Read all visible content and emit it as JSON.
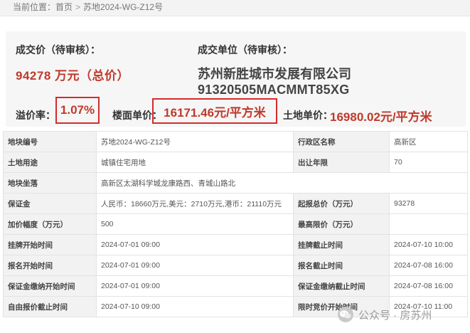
{
  "breadcrumb": {
    "prefix": "当前位置：",
    "home": "首页",
    "separator": ">",
    "current": "苏地2024-WG-Z12号"
  },
  "summary": {
    "price_label": "成交价（待审核）：",
    "price_value": "94278 万元（总价）",
    "company_label": "成交单位（待审核）：",
    "company_name": "苏州新胜城市发展有限公司",
    "company_code": "91320505MACMMT85XG",
    "premium_label": "溢价率：",
    "premium_value": "1.07%",
    "floor_price_label": "楼面单价：",
    "floor_price_value": "16171.46元/平方米",
    "land_price_label": "土地单价：",
    "land_price_value": "16980.02元/平方米"
  },
  "table": {
    "rows": [
      {
        "k1": "地块编号",
        "v1": "苏地2024-WG-Z12号",
        "k2": "行政区名称",
        "v2": "高新区"
      },
      {
        "k1": "土地用途",
        "v1": "城镇住宅用地",
        "k2": "出让年限",
        "v2": "70"
      },
      {
        "k1": "地块坐落",
        "v1": "高新区太湖科学城龙康路西、青城山路北"
      },
      {
        "k1": "保证金",
        "v1": "人民币：18660万元,美元：2710万元,港币：21110万元",
        "k2": "起报总价（万元）",
        "v2": "93278"
      },
      {
        "k1": "加价幅度（万元）",
        "v1": "500",
        "k2": "最高限价（万元）",
        "v2": ""
      },
      {
        "k1": "挂牌开始时间",
        "v1": "2024-07-01 09:00",
        "k2": "挂牌截止时间",
        "v2": "2024-07-10 10:00"
      },
      {
        "k1": "报名开始时间",
        "v1": "2024-07-01 09:00",
        "k2": "报名截止时间",
        "v2": "2024-07-08 16:00"
      },
      {
        "k1": "保证金缴纳开始时间",
        "v1": "2024-07-01 09:00",
        "k2": "保证金缴纳截止时间",
        "v2": "2024-07-08 16:00"
      },
      {
        "k1": "自由报价截止时间",
        "v1": "2024-07-10 09:00",
        "k2": "限时竞价开始时间",
        "v2": "2024-07-10 11:00"
      }
    ]
  },
  "watermark": {
    "text": "公众号 · 房苏州",
    "icon": "wechat-icon"
  },
  "colors": {
    "accent_red": "#c0392b",
    "box_red": "#d52b2b",
    "panel_bg": "#f6f6f6",
    "label_bg": "#f2f2f2"
  }
}
